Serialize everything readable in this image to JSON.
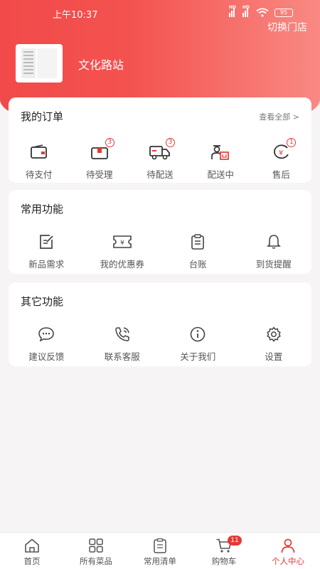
{
  "status_bar": {
    "time": "上午10:37",
    "battery": "95"
  },
  "header": {
    "switch_store_label": "切换门店",
    "store_name": "文化路站"
  },
  "orders": {
    "title": "我的订单",
    "view_all": "查看全部 >",
    "items": [
      {
        "label": "待支付",
        "icon": "wallet-icon",
        "badge": ""
      },
      {
        "label": "待受理",
        "icon": "gift-box-icon",
        "badge": "3"
      },
      {
        "label": "待配送",
        "icon": "truck-icon",
        "badge": "3"
      },
      {
        "label": "配送中",
        "icon": "courier-icon",
        "badge": ""
      },
      {
        "label": "售后",
        "icon": "after-sales-icon",
        "badge": "1"
      }
    ]
  },
  "common_functions": {
    "title": "常用功能",
    "items": [
      {
        "label": "新品需求",
        "icon": "edit-note-icon"
      },
      {
        "label": "我的优惠券",
        "icon": "coupon-icon"
      },
      {
        "label": "台账",
        "icon": "clipboard-icon"
      },
      {
        "label": "到货提醒",
        "icon": "bell-icon"
      }
    ]
  },
  "other_functions": {
    "title": "其它功能",
    "items": [
      {
        "label": "建议反馈",
        "icon": "chat-icon"
      },
      {
        "label": "联系客服",
        "icon": "phone-icon"
      },
      {
        "label": "关于我们",
        "icon": "info-icon"
      },
      {
        "label": "设置",
        "icon": "gear-icon"
      }
    ]
  },
  "tabbar": {
    "active_color": "#e53935",
    "items": [
      {
        "label": "首页",
        "icon": "home-icon"
      },
      {
        "label": "所有菜品",
        "icon": "grid-icon"
      },
      {
        "label": "常用清单",
        "icon": "list-icon"
      },
      {
        "label": "购物车",
        "icon": "cart-icon",
        "badge": "11"
      },
      {
        "label": "个人中心",
        "icon": "person-icon",
        "active": true
      }
    ]
  }
}
